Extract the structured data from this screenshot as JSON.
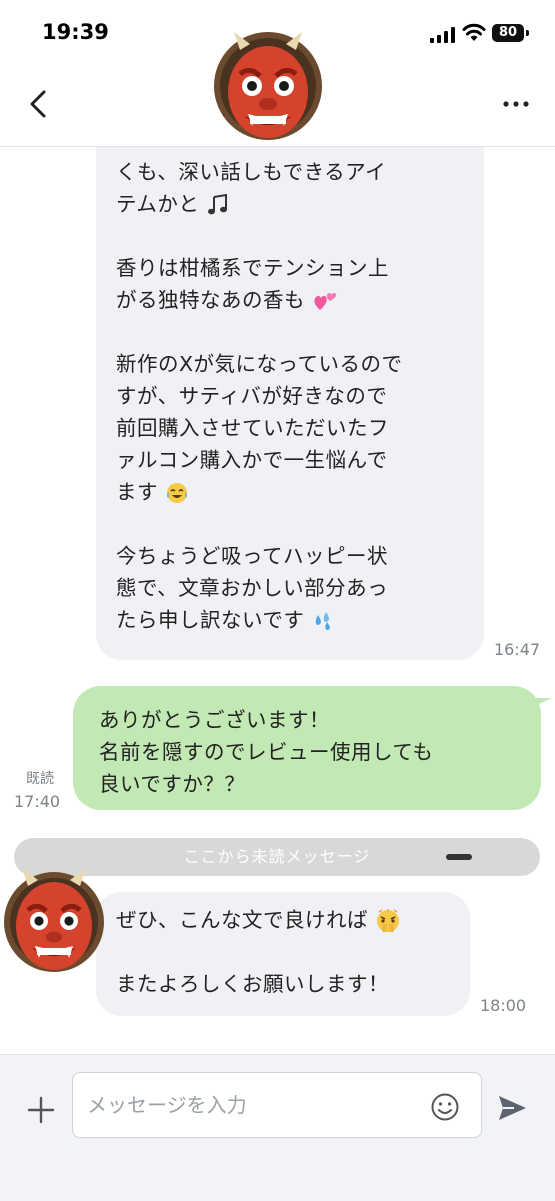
{
  "status_bar": {
    "time": "19:39",
    "battery": "80"
  },
  "chat": {
    "incoming_1": {
      "lines": [
        "くも、深い話しもできるアイ",
        "テムかと",
        "",
        "香りは柑橘系でテンション上",
        "がる独特なあの香も",
        "",
        "新作のXが気になっているので",
        "すが、サティバが好きなので",
        "前回購入させていただいたフ",
        "ァルコン購入かで一生悩んで",
        "ます",
        "",
        "今ちょうど吸ってハッピー状",
        "態で、文章おかしい部分あっ",
        "たら申し訳ないです"
      ],
      "time": "16:47"
    },
    "outgoing_1": {
      "lines": [
        "ありがとうございます！",
        "名前を隠すのでレビュー使用しても",
        "良いですか？？"
      ],
      "read_label": "既読",
      "time": "17:40"
    },
    "unread_divider": "ここから未読メッセージ",
    "incoming_2": {
      "lines": [
        "ぜひ、こんな文で良ければ",
        "",
        "またよろしくお願いします！"
      ],
      "time": "18:00"
    }
  },
  "input": {
    "placeholder": "メッセージを入力"
  },
  "icons": {
    "avatar": "red-oni-face-icon",
    "music": "music-note-icon",
    "heart": "pink-hearts-icon",
    "laugh": "tears-of-joy-icon",
    "sweat": "sweat-drops-icon",
    "shy": "shushing-face-icon"
  },
  "colors": {
    "outgoing_bubble": "#c2e8b4",
    "incoming_bubble": "#eff1f4",
    "divider": "#d8d8d8"
  }
}
